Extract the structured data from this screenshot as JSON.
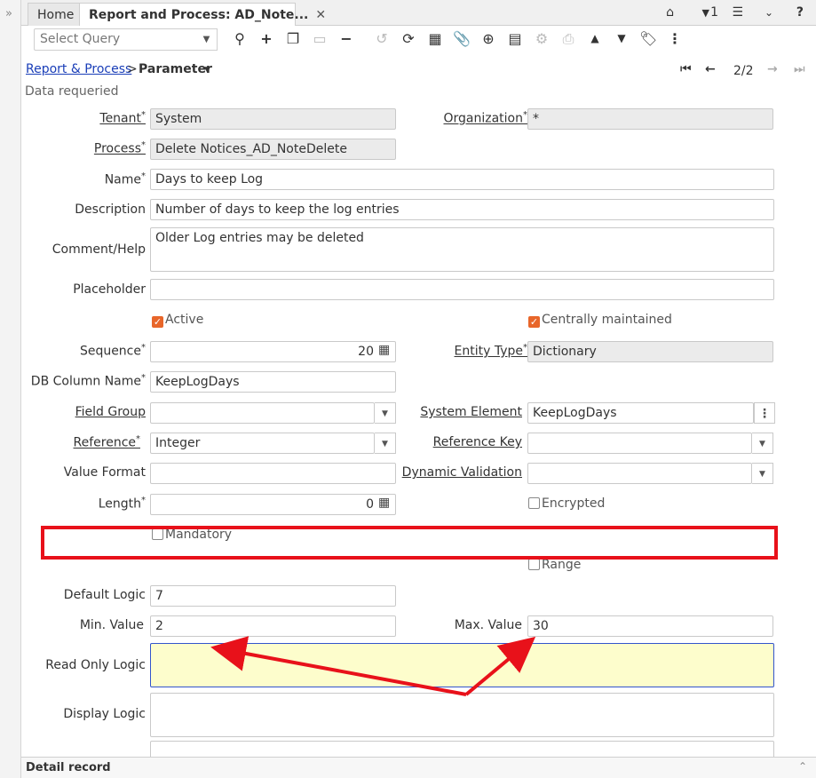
{
  "tabs": [
    {
      "label": "Home"
    },
    {
      "label": "Report and Process: AD_Note...",
      "close": "✕"
    }
  ],
  "topbar": {
    "home_icon": "home-icon",
    "notifications_count": "1",
    "menu_icon": "menu-icon",
    "collapse_icon": "chevrons-down-icon",
    "help_icon": "help-icon"
  },
  "toolbar": {
    "query_placeholder": "Select Query"
  },
  "breadcrumb": {
    "parent": "Report & Process",
    "separator": ">",
    "current": "Parameter"
  },
  "record_nav": {
    "position": "2/2"
  },
  "status_message": "Data requeried",
  "fields": {
    "tenant": {
      "label": "Tenant",
      "value": "System"
    },
    "organization": {
      "label": "Organization",
      "value": "*"
    },
    "process": {
      "label": "Process",
      "value": "Delete Notices_AD_NoteDelete"
    },
    "name": {
      "label": "Name",
      "value": "Days to keep Log"
    },
    "description": {
      "label": "Description",
      "value": "Number of days to keep the log entries"
    },
    "comment_help": {
      "label": "Comment/Help",
      "value": "Older Log entries may be deleted"
    },
    "placeholder": {
      "label": "Placeholder",
      "value": ""
    },
    "active": {
      "label": "Active",
      "checked": true
    },
    "centrally_maintained": {
      "label": "Centrally maintained",
      "checked": true
    },
    "sequence": {
      "label": "Sequence",
      "value": "20"
    },
    "entity_type": {
      "label": "Entity Type",
      "value": "Dictionary"
    },
    "db_column_name": {
      "label": "DB Column Name",
      "value": "KeepLogDays"
    },
    "field_group": {
      "label": "Field Group",
      "value": ""
    },
    "system_element": {
      "label": "System Element",
      "value": "KeepLogDays"
    },
    "reference": {
      "label": "Reference",
      "value": "Integer"
    },
    "reference_key": {
      "label": "Reference Key",
      "value": ""
    },
    "value_format": {
      "label": "Value Format",
      "value": ""
    },
    "dynamic_validation": {
      "label": "Dynamic Validation",
      "value": ""
    },
    "length": {
      "label": "Length",
      "value": "0"
    },
    "encrypted": {
      "label": "Encrypted",
      "checked": false
    },
    "mandatory": {
      "label": "Mandatory",
      "checked": false
    },
    "range": {
      "label": "Range",
      "checked": false
    },
    "default_logic": {
      "label": "Default Logic",
      "value": "7"
    },
    "min_value": {
      "label": "Min. Value",
      "value": "2"
    },
    "max_value": {
      "label": "Max. Value",
      "value": "30"
    },
    "read_only_logic": {
      "label": "Read Only Logic",
      "value": ""
    },
    "display_logic": {
      "label": "Display Logic",
      "value": ""
    }
  },
  "required_marker": "*",
  "footer": {
    "title": "Detail record"
  },
  "colors": {
    "highlight": "#e8111a",
    "accent": "#e8662a",
    "link": "#1a3eb8",
    "readonly_bg": "#ebebeb",
    "focus_bg": "#fdfdcc"
  }
}
